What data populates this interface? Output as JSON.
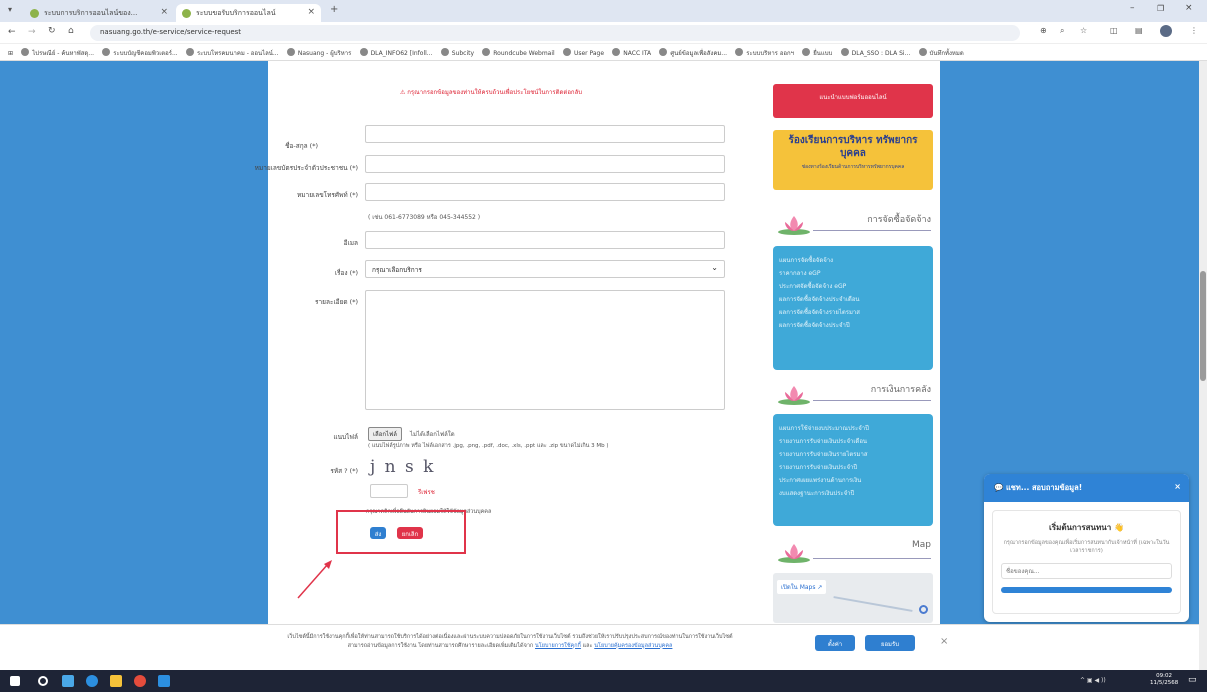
{
  "browser": {
    "tabs": [
      {
        "label": "ระบบการบริการออนไลน์ของ..."
      },
      {
        "label": "ระบบขอรับบริการออนไลน์"
      }
    ],
    "url": "nasuang.go.th/e-service/service-request",
    "bookmarks": [
      "ไปรษณีย์ - ค้นหาพัสดุ...",
      "ระบบบัญชีคอมพิวเตอร์...",
      "ระบบโทรคมนาคม - ออนไลน์...",
      "Nasuang - ผู้บริหาร",
      "DLA_INFO62 [Infoll...",
      "Subcity",
      "Roundcube Webmail",
      "User Page",
      "NACC ITA",
      "ศูนย์ข้อมูลเพื่อสังคม...",
      "ระบบบริหาร ออกฯ",
      "ยื่นแบบ",
      "DLA_SSO : DLA Si...",
      "บันทึกทั้งหมด"
    ]
  },
  "form": {
    "warning": "กรุณากรอกข้อมูลของท่านให้ครบถ้วนเพื่อประโยชน์ในการติดต่อกลับ",
    "name_label": "ชื่อ-สกุล (*)",
    "idcard_label": "หมายเลขบัตรประจำตัวประชาชน (*)",
    "phone_label": "หมายเลขโทรศัพท์ (*)",
    "phone_note": "( เช่น 061-6773089 หรือ 045-344552 )",
    "email_label": "อีเมล",
    "subject_label": "เรื่อง (*)",
    "subject_value": "กรุณาเลือกบริการ",
    "detail_label": "รายละเอียด (*)",
    "attach_label": "แนบไฟล์",
    "choose_file": "เลือกไฟล์",
    "no_file": "ไม่ได้เลือกไฟล์ใด",
    "attach_note": "( แนบไฟล์รูปภาพ หรือ ไฟล์เอกสาร .jpg, .png, .pdf, .doc, .xls, .ppt และ .zip ขนาดไม่เกิน 3 Mb )",
    "captcha_label": "รหัส ? (*)",
    "captcha_text": "j n s k",
    "refresh": "รีเฟรช",
    "consent": "กรุณาคลิกเพื่อยืนยันการยินยอมให้ใช้ข้อมูลส่วนบุคคล",
    "submit": "ส่ง",
    "cancel": "ยกเลิก"
  },
  "sidebar": {
    "top_banner": "แนะนำแบบฟอร์มออนไลน์",
    "complaint_title": "ร้องเรียนการบริหาร ทรัพยากรบุคคล",
    "complaint_sub": "ช่องทางร้องเรียนด้านการบริหารทรัพยากรบุคคล",
    "procurement_title": "การจัดซื้อจัดจ้าง",
    "procurement_links": [
      "แผนการจัดซื้อจัดจ้าง",
      "ราคากลาง eGP",
      "ประกาศจัดซื้อจัดจ้าง eGP",
      "ผลการจัดซื้อจัดจ้างประจำเดือน",
      "ผลการจัดซื้อจัดจ้างรายไตรมาส",
      "ผลการจัดซื้อจัดจ้างประจำปี"
    ],
    "finance_title": "การเงินการคลัง",
    "finance_links": [
      "แผนการใช้จ่ายงบประมาณประจำปี",
      "รายงานการรับจ่ายเงินประจำเดือน",
      "รายงานการรับจ่ายเงินรายไตรมาส",
      "รายงานการรับจ่ายเงินประจำปี",
      "ประกาศเผยแพร่งานด้านการเงิน",
      "งบแสดงฐานะการเงินประจำปี"
    ],
    "map_title": "Map",
    "map_link": "เปิดใน Maps"
  },
  "chat": {
    "title": "แชท... สอบถามข้อมูล!",
    "heading": "เริ่มต้นการสนทนา",
    "desc": "กรุณากรอกข้อมูลของคุณเพื่อเริ่มการสนทนากับเจ้าหน้าที่ (เฉพาะในวันเวลาราชการ)",
    "name_placeholder": "ชื่อของคุณ..."
  },
  "cookie": {
    "text": "เว็บไซต์นี้มีการใช้งานคุกกี้เพื่อให้ท่านสามารถใช้บริการได้อย่างต่อเนื่องและผ่านระบบความปลอดภัยในการใช้งานเว็บไซต์ รวมถึงช่วยให้เราปรับปรุงประสบการณ์ของท่านในการใช้งานเว็บไซต์",
    "text2": "สามารถอ่านข้อมูลการใช้งาน โดยท่านสามารถศึกษารายละเอียดเพิ่มเติมได้จาก",
    "policy1": "นโยบายการใช้คุกกี้",
    "and": "และ",
    "policy2": "นโยบายคุ้มครองข้อมูลส่วนบุคคล",
    "settings": "ตั้งค่า",
    "accept": "ยอมรับ"
  },
  "taskbar": {
    "time": "09:02",
    "date": "11/5/2568"
  },
  "colors": {
    "page_blue": "#3f8fd2",
    "link_blue": "#3fa9d8",
    "annotation_red": "#e0344a"
  }
}
